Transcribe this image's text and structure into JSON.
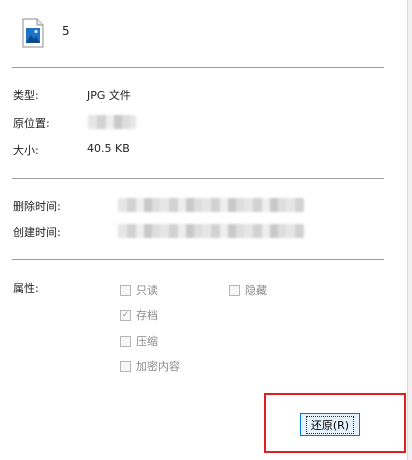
{
  "file": {
    "name": "5",
    "icon": "jpg-image-file-icon"
  },
  "info": {
    "type_label": "类型:",
    "type_value": "JPG 文件",
    "location_label": "原位置:",
    "size_label": "大小:",
    "size_value": "40.5 KB"
  },
  "times": {
    "deleted_label": "删除时间:",
    "created_label": "创建时间:"
  },
  "attributes": {
    "label": "属性:",
    "readonly": "只读",
    "hidden": "隐藏",
    "archive": "存档",
    "compress": "压缩",
    "encrypt": "加密内容"
  },
  "actions": {
    "restore": "还原(R)"
  },
  "colors": {
    "highlight": "#e02020",
    "button_border": "#0078d7",
    "button_bg": "#e5f1fb"
  }
}
